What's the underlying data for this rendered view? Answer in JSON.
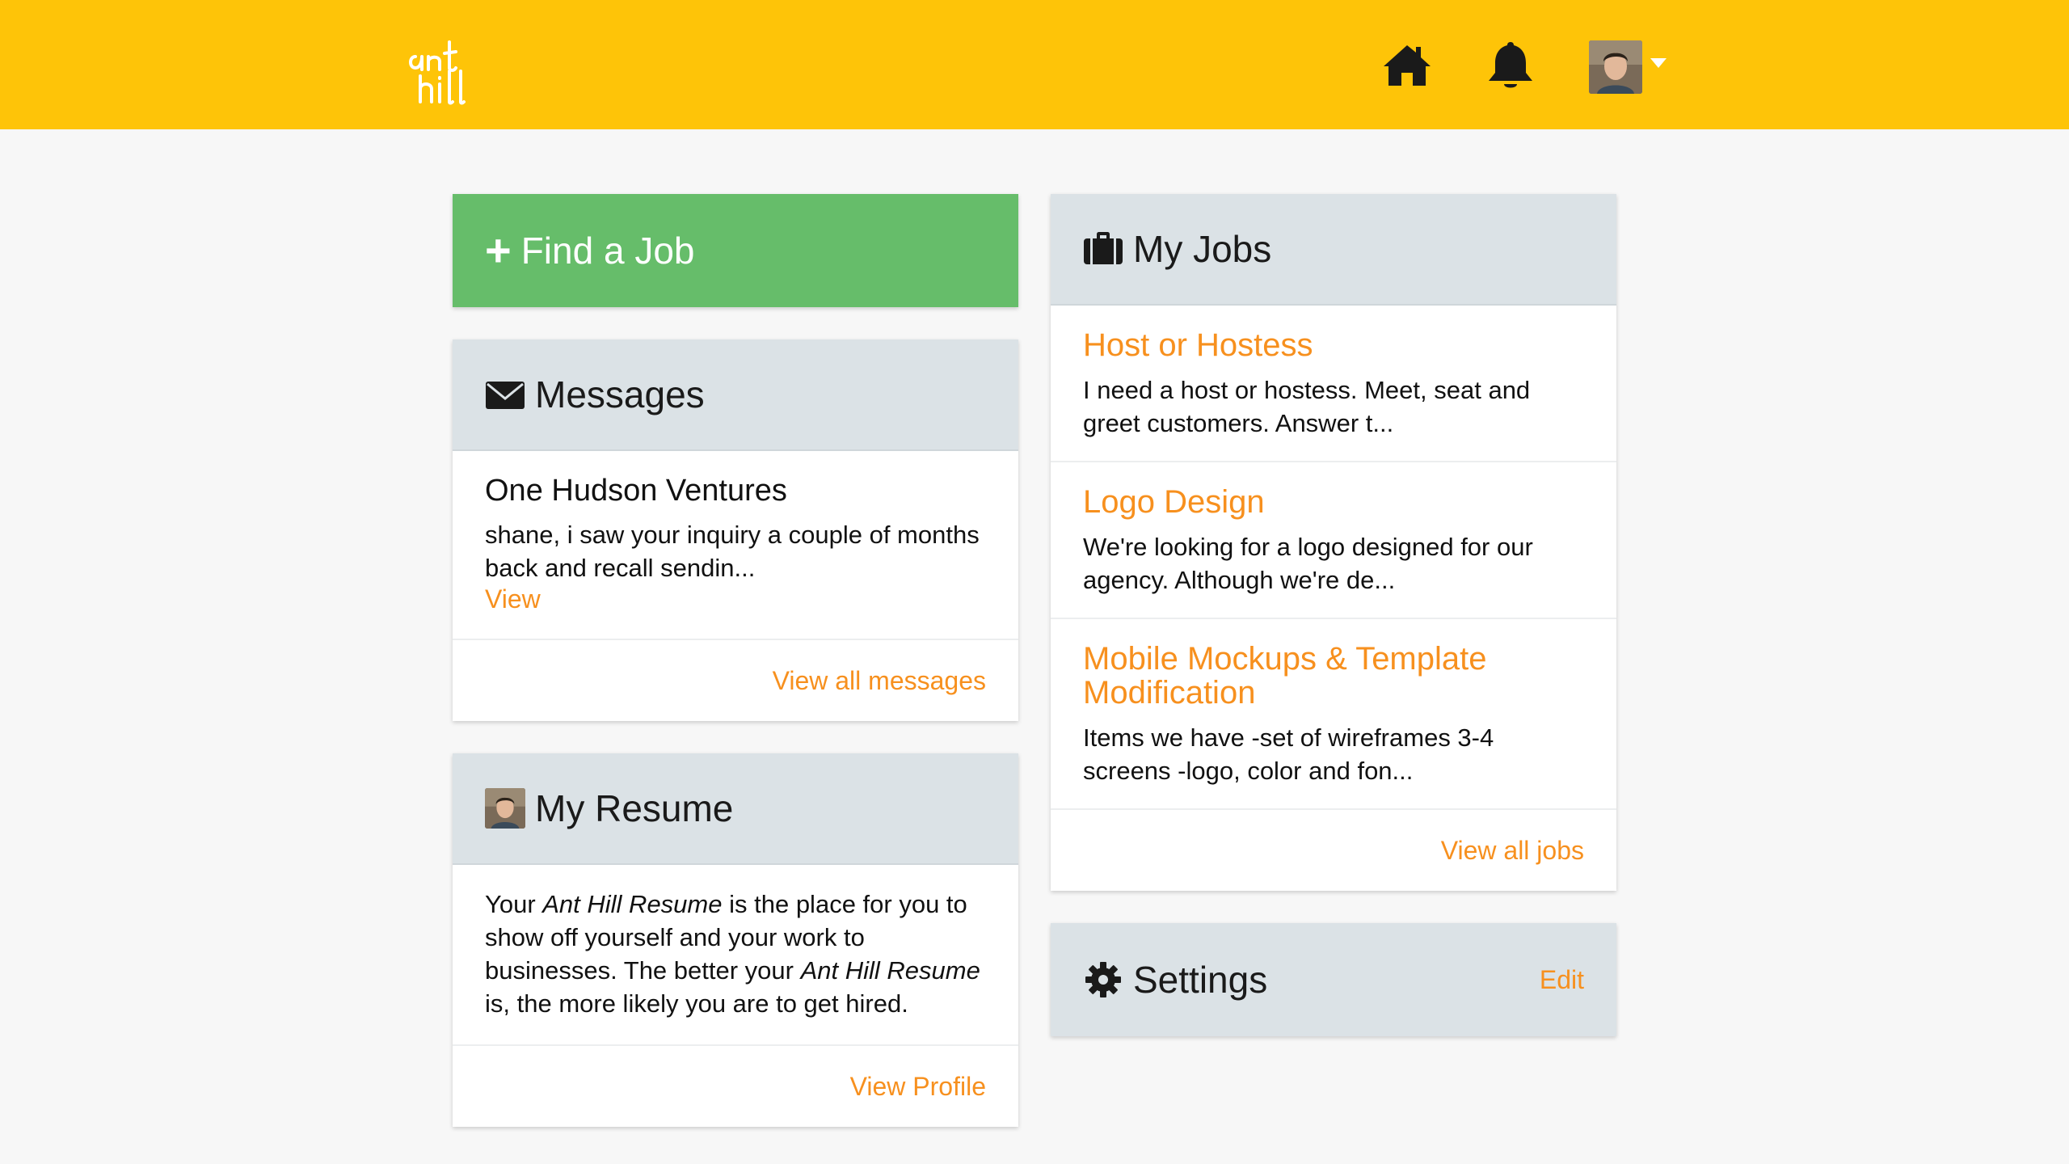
{
  "header": {
    "logo_text": "ant hill",
    "colors": {
      "brand": "#fec408",
      "accent": "#f7901e",
      "success": "#66bd6a"
    }
  },
  "find_job": {
    "label": "Find a Job"
  },
  "messages": {
    "title": "Messages",
    "items": [
      {
        "sender": "One Hudson Ventures",
        "preview": "shane, i saw your inquiry a couple of months back and recall sendin...",
        "link": "View"
      }
    ],
    "footer_link": "View all messages"
  },
  "resume": {
    "title": "My Resume",
    "text": {
      "p1": "Your ",
      "em1": "Ant Hill Resume",
      "p2": " is the place for you to show off yourself and your work to businesses. The better your ",
      "em2": "Ant Hill Resume",
      "p3": " is, the more likely you are to get hired."
    },
    "footer_link": "View Profile"
  },
  "jobs": {
    "title": "My Jobs",
    "items": [
      {
        "title": "Host or Hostess",
        "desc": "I need a host or hostess. Meet, seat and greet customers. Answer t..."
      },
      {
        "title": "Logo Design",
        "desc": "We're looking for a logo designed for our agency. Although we're de..."
      },
      {
        "title": "Mobile Mockups & Template Modification",
        "desc": "Items we have -set of wireframes 3-4 screens -logo, color and fon..."
      }
    ],
    "footer_link": "View all jobs"
  },
  "settings": {
    "title": "Settings",
    "edit": "Edit"
  }
}
